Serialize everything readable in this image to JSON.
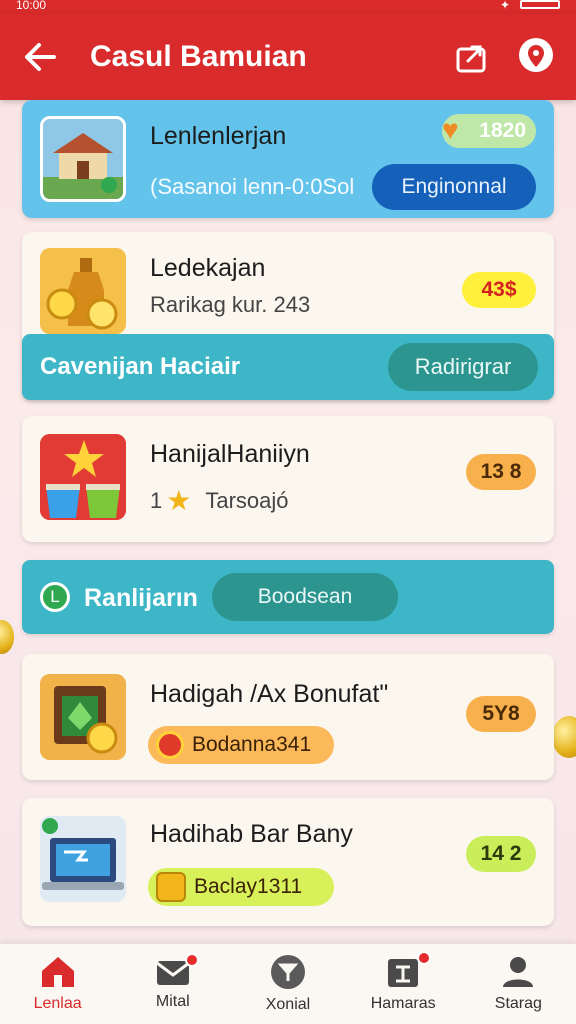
{
  "status_bar": {
    "time": "10:00"
  },
  "header": {
    "title": "Casul Bamuian"
  },
  "items": [
    {
      "title": "Lenlenlerjan",
      "subtitle": "(Sasanoi lenn-0:0Sol",
      "badge": "1820",
      "action": "Enginonnal"
    },
    {
      "title": "Ledekajan",
      "subtitle": "Rarikag kur. 243",
      "badge": "43$"
    },
    {
      "title": "HanijalHaniiyn",
      "subtitle_prefix": "1",
      "subtitle": "Tarsoajó",
      "badge": "13 8"
    },
    {
      "title": "Hadigah /Ax Bonufat\"",
      "chip": "Bodanna341",
      "badge": "5Y8"
    },
    {
      "title": "Hadihab Bar Bany",
      "chip": "Baclay1311",
      "badge": "14 2"
    }
  ],
  "band1": {
    "label": "Cavenijan Haciair",
    "button": "Radirigrar"
  },
  "band2": {
    "label": "Ranlijarın",
    "button": "Boodsean"
  },
  "nav": [
    {
      "label": "Lenlaa",
      "icon": "home-icon",
      "active": true
    },
    {
      "label": "Mital",
      "icon": "mail-icon",
      "active": false
    },
    {
      "label": "Xonial",
      "icon": "compass-icon",
      "active": false
    },
    {
      "label": "Hamaras",
      "icon": "gift-icon",
      "active": false
    },
    {
      "label": "Starag",
      "icon": "profile-icon",
      "active": false
    }
  ],
  "colors": {
    "primary": "#d92b2b",
    "teal": "#3db7c8",
    "sky": "#63c3ea",
    "card": "#fbf7ef"
  }
}
